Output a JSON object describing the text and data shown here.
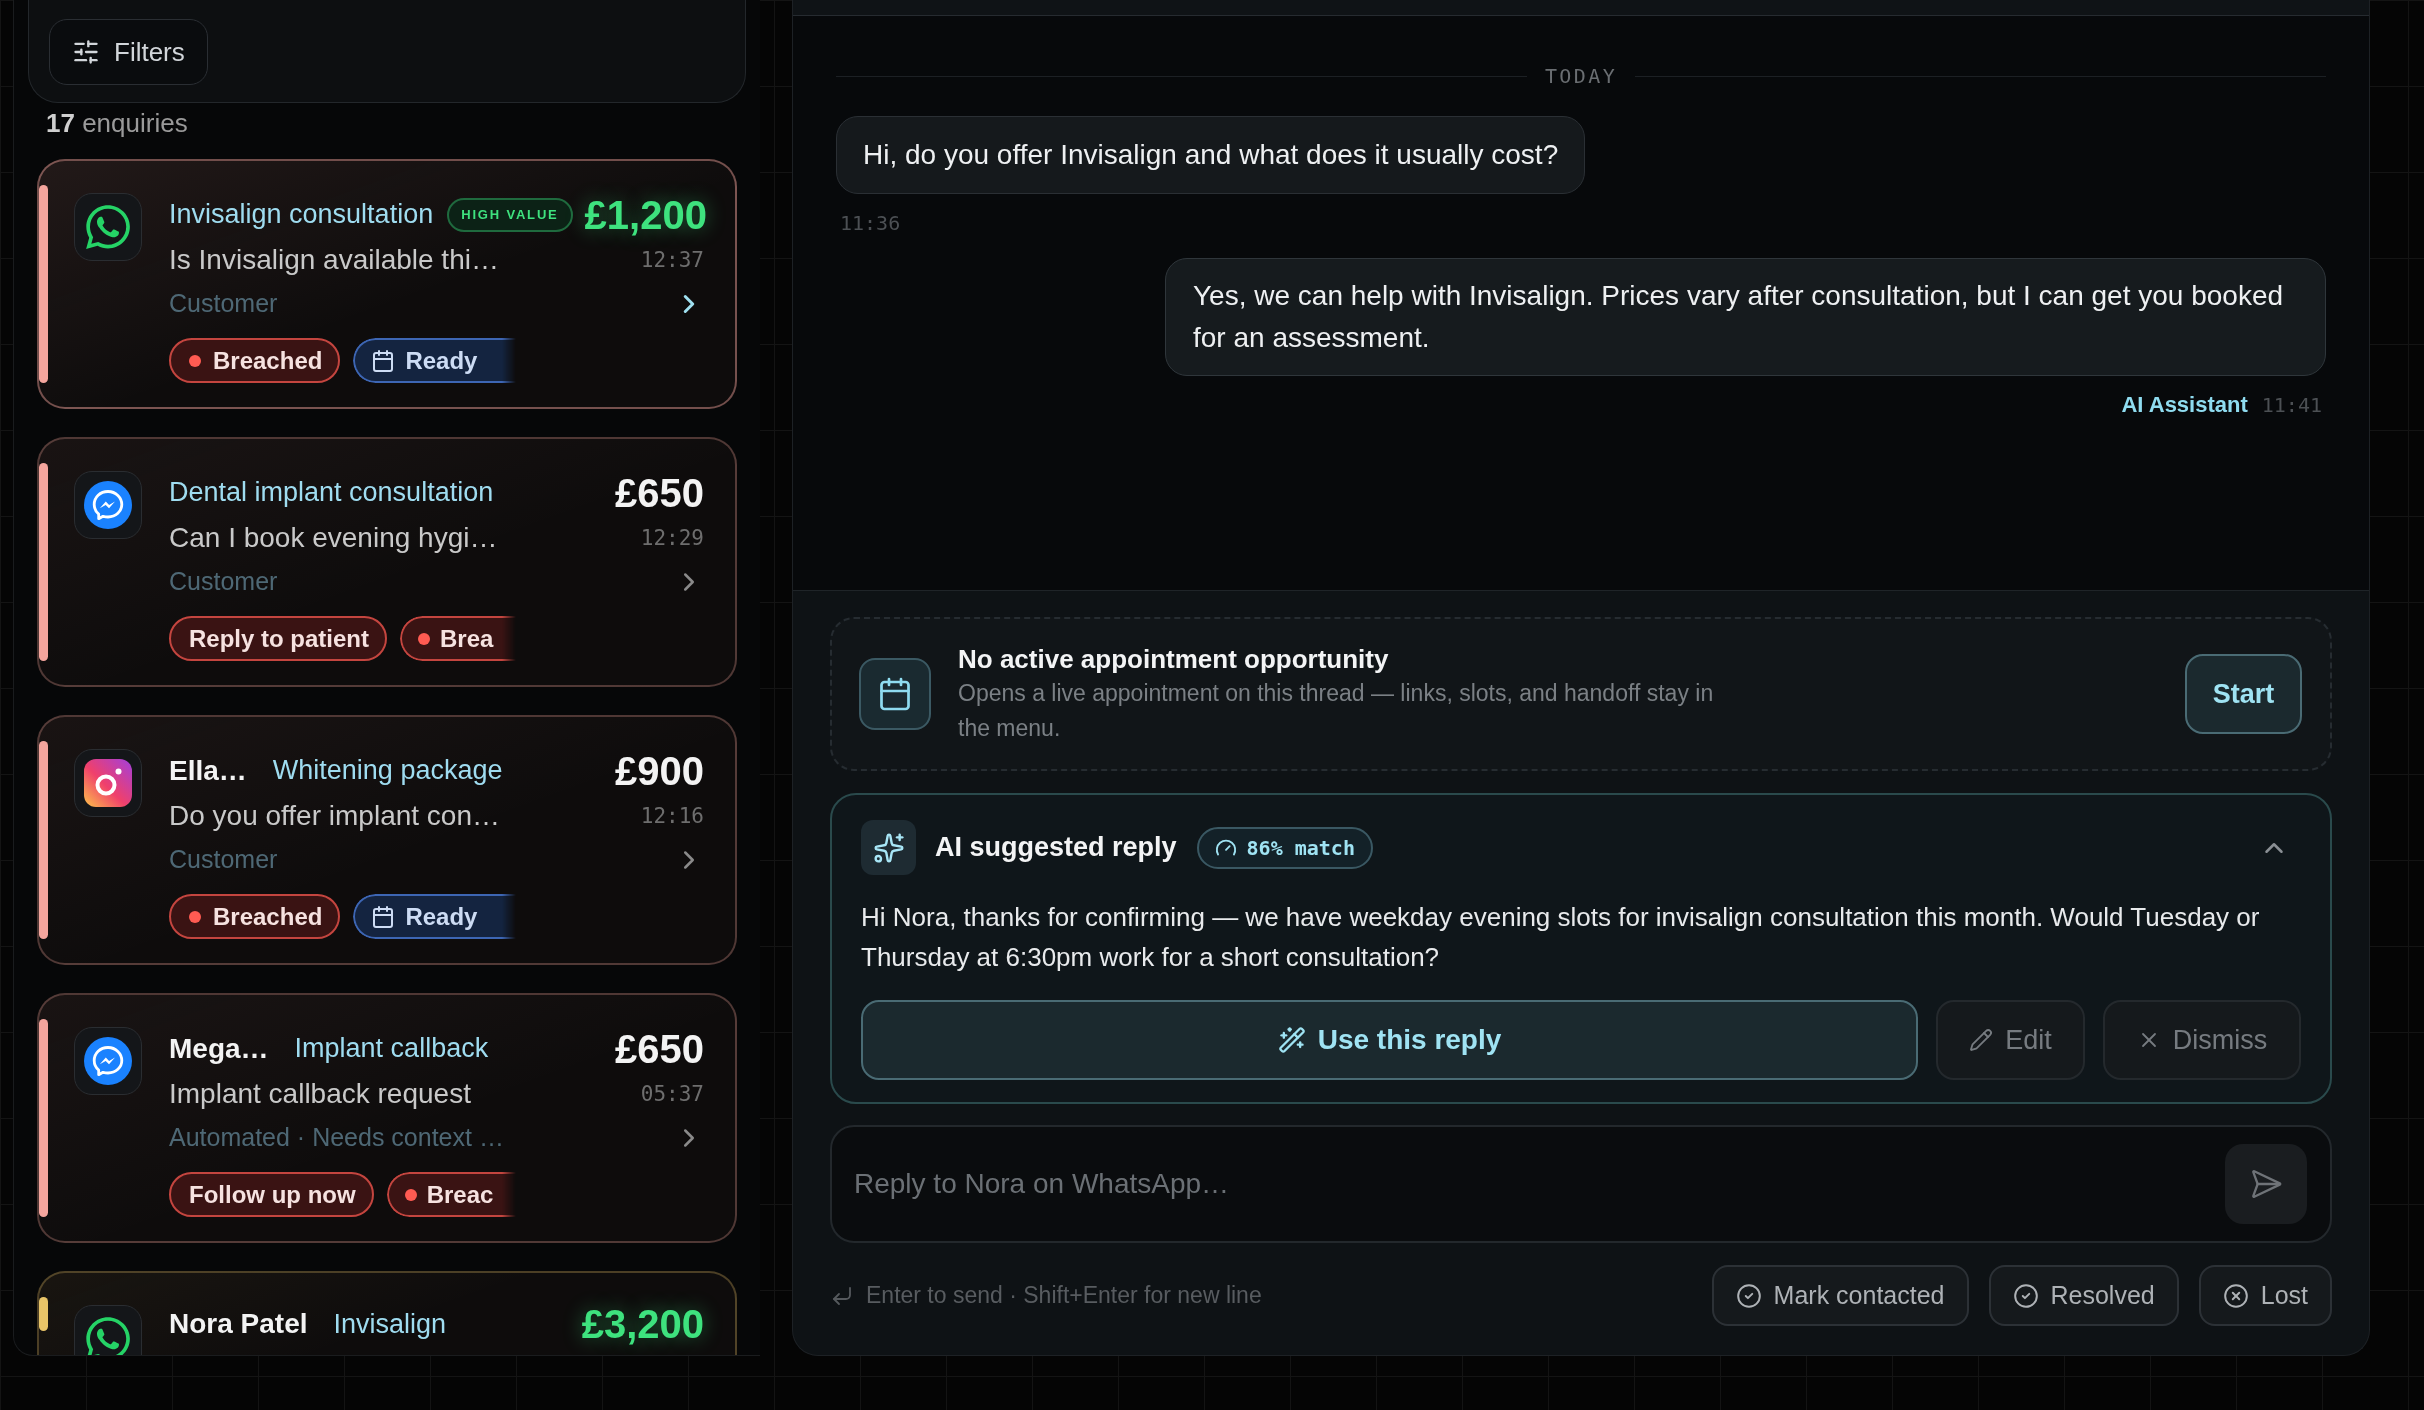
{
  "filters_button": {
    "label": "Filters"
  },
  "enquiry_count": "**17** enquiries",
  "enquiries": [
    {
      "kind": "whatsapp",
      "color": "#f4a59d",
      "selected": true,
      "subject": "Invisalign consultation",
      "badge": "HIGH VALUE",
      "price": "£1,200",
      "price_highlighted": true,
      "preview": "Is Invisalign available thi…",
      "time": "12:37",
      "meta": "Customer",
      "tags": [
        {
          "kind": "alert",
          "label": "Breached"
        },
        {
          "kind": "booking",
          "label": "Ready"
        }
      ]
    },
    {
      "kind": "messenger",
      "color": "#f4a59d",
      "selected": false,
      "subject": "Dental implant consultation",
      "price": "£650",
      "price_highlighted": false,
      "preview": "Can I book evening hygi…",
      "time": "12:29",
      "meta": "Customer",
      "tags": [
        {
          "kind": "action",
          "label": "Reply to patient"
        },
        {
          "kind": "alert",
          "label": "Brea"
        }
      ]
    },
    {
      "kind": "instagram",
      "color": "#f4a59d",
      "selected": false,
      "name": "Ella…",
      "subject": "Whitening package",
      "price": "£900",
      "price_highlighted": false,
      "preview": "Do you offer implant con…",
      "time": "12:16",
      "meta": "Customer",
      "tags": [
        {
          "kind": "alert",
          "label": "Breached"
        },
        {
          "kind": "booking",
          "label": "Ready"
        }
      ]
    },
    {
      "kind": "messenger",
      "color": "#f4a59d",
      "selected": false,
      "name": "Mega…",
      "subject": "Implant callback",
      "price": "£650",
      "price_highlighted": false,
      "preview": "Implant callback request",
      "time": "05:37",
      "meta": "Automated · Needs context …",
      "tags": [
        {
          "kind": "action",
          "label": "Follow up now"
        },
        {
          "kind": "alert",
          "label": "Breac"
        }
      ]
    },
    {
      "kind": "whatsapp",
      "color": "#e8c468",
      "selected": false,
      "name": "Nora Patel",
      "subject": "Invisalign",
      "price": "£3,200",
      "price_highlighted": true
    }
  ],
  "thread": {
    "date_divider": "TODAY",
    "messages": [
      {
        "kind": "inbound",
        "text": "Hi, do you offer Invisalign and what does it usually cost?",
        "time": "11:36"
      },
      {
        "kind": "outbound",
        "text": "Yes, we can help with Invisalign. Prices vary after consultation, but I can get you booked for an assessment.",
        "sender": "AI Assistant",
        "time": "11:41"
      }
    ]
  },
  "appointment": {
    "title": "No active appointment opportunity",
    "description": "Opens a live appointment on this thread — links, slots, and handoff stay in the menu.",
    "button": "Start"
  },
  "ai_suggestion": {
    "title": "AI suggested reply",
    "match": "86% match",
    "expanded": true,
    "text": "Hi Nora, thanks for confirming — we have weekday evening slots for invisalign consultation this month. Would Tuesday or Thursday at 6:30pm work for a short consultation?",
    "buttons": [
      {
        "kind": "primary",
        "label": "Use this reply"
      },
      {
        "kind": "edit",
        "label": "Edit"
      },
      {
        "kind": "dismiss",
        "label": "Dismiss"
      }
    ]
  },
  "composer": {
    "placeholder": "Reply to Nora on WhatsApp…",
    "hint": "Enter to send · Shift+Enter for new line",
    "actions": [
      {
        "kind": "contacted",
        "label": "Mark contacted"
      },
      {
        "kind": "resolved",
        "label": "Resolved"
      },
      {
        "kind": "lost",
        "label": "Lost"
      }
    ]
  }
}
